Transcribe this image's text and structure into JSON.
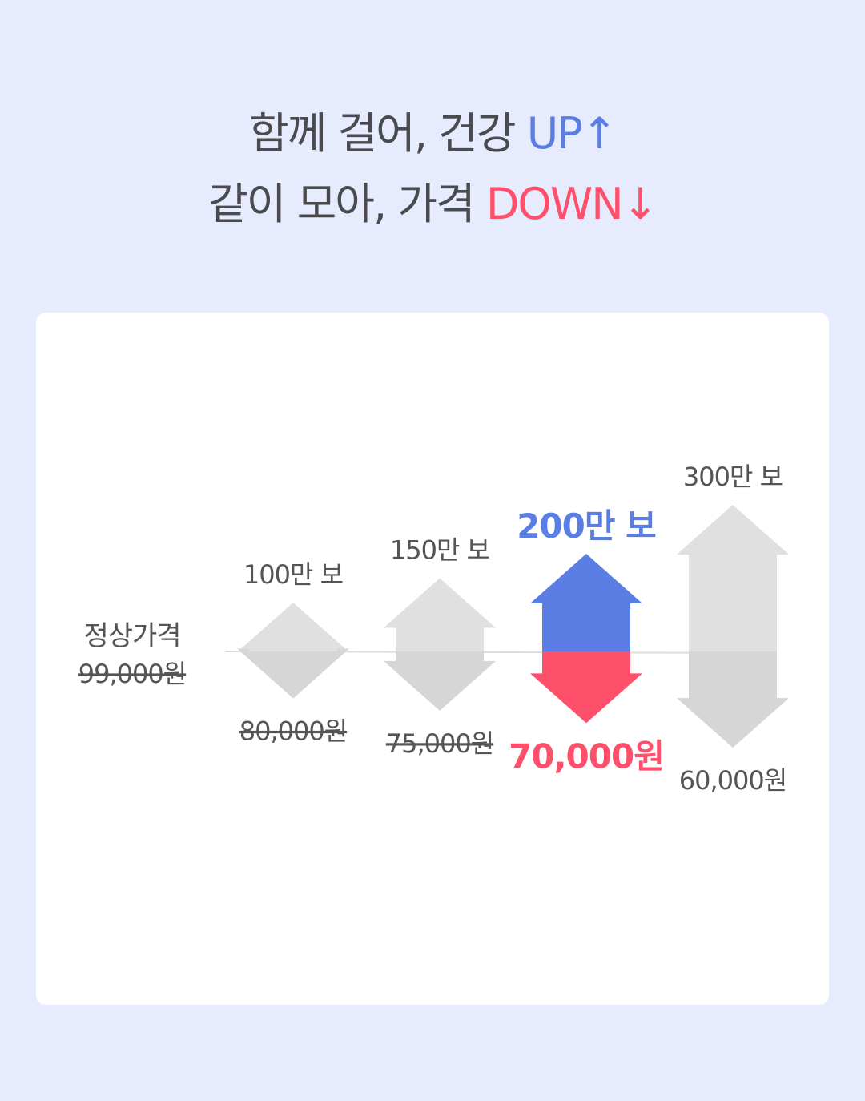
{
  "headline": {
    "line1_text": "함께 걸어, 건강 ",
    "line1_accent": "UP",
    "line1_arrow": "↑",
    "line2_text": "같이 모아, 가격 ",
    "line2_accent": "DOWN",
    "line2_arrow": "↓"
  },
  "colors": {
    "background": "#e6ebfd",
    "card": "#ffffff",
    "up_accent": "#5b7ee5",
    "down_accent": "#ff506b",
    "inactive_up": "#e0e0e0",
    "inactive_down": "#d6d6d6"
  },
  "chart_data": {
    "type": "bar",
    "baseline_label": "정상가격",
    "baseline_price_label": "99,000원",
    "baseline_price": 99000,
    "categories": [
      "100만 보",
      "150만 보",
      "200만 보",
      "300만 보"
    ],
    "steps": [
      1000000,
      1500000,
      2000000,
      3000000
    ],
    "price_labels": [
      "80,000원",
      "75,000원",
      "70,000원",
      "60,000원"
    ],
    "prices": [
      80000,
      75000,
      70000,
      60000
    ],
    "strikethrough": [
      true,
      true,
      false,
      false
    ],
    "highlighted_index": 2
  }
}
